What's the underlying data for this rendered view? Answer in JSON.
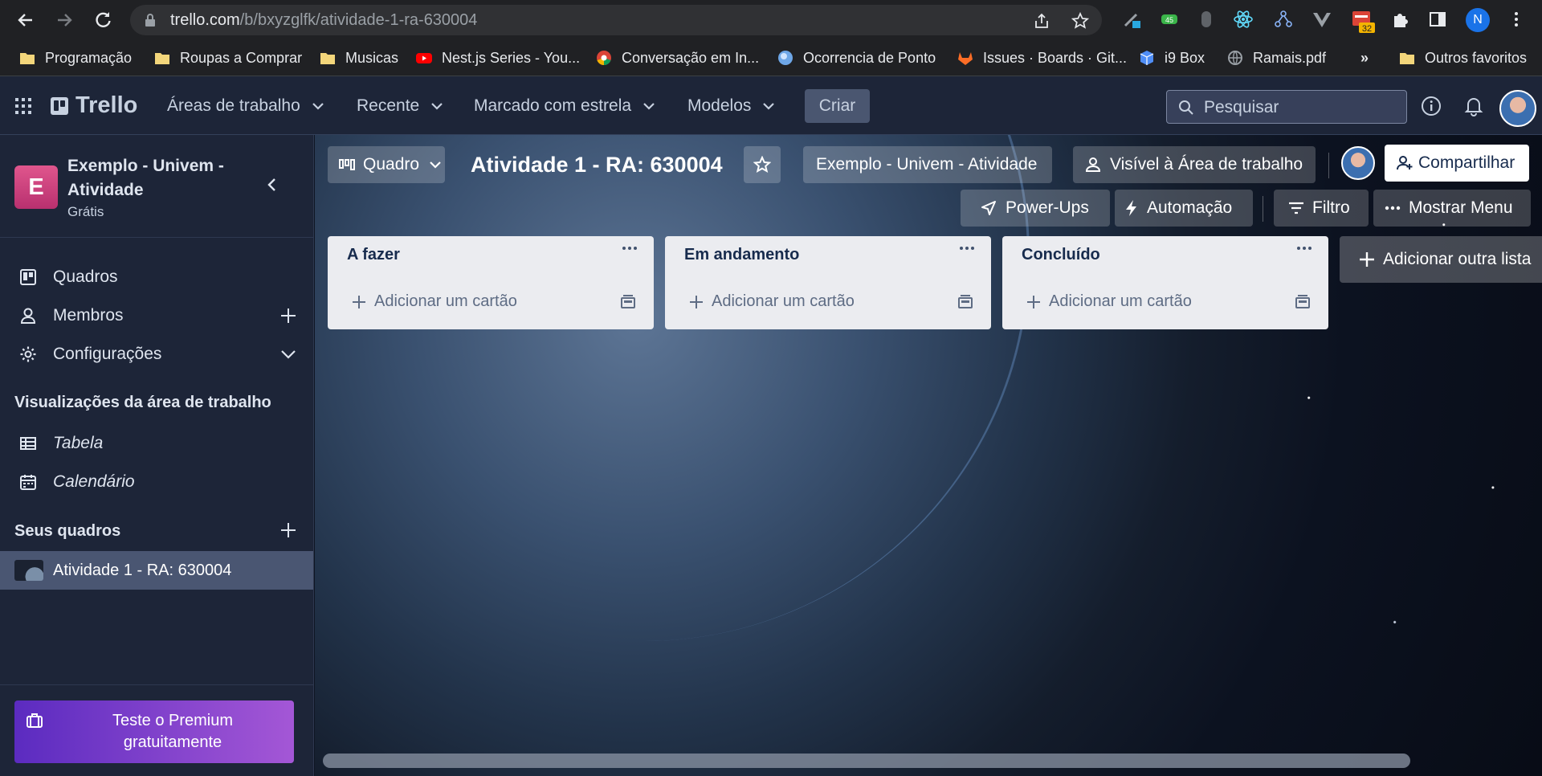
{
  "browser": {
    "url_domain": "trello.com",
    "url_path": "/b/bxyzglfk/atividade-1-ra-630004",
    "ext_badge": "32",
    "profile_initial": "N",
    "bookmarks": [
      {
        "label": "Programação",
        "icon": "folder-icon"
      },
      {
        "label": "Roupas a Comprar",
        "icon": "folder-icon"
      },
      {
        "label": "Musicas",
        "icon": "folder-icon"
      },
      {
        "label": "Nest.js Series - You...",
        "icon": "youtube-icon"
      },
      {
        "label": "Conversação em In...",
        "icon": "chrome-icon"
      },
      {
        "label": "Ocorrencia de Ponto",
        "icon": "globe-icon"
      },
      {
        "label": "Issues · Boards · Git...",
        "icon": "gitlab-icon"
      },
      {
        "label": "i9 Box",
        "icon": "box-icon"
      },
      {
        "label": "Ramais.pdf",
        "icon": "web-icon"
      }
    ],
    "overflow": "»",
    "other_favorites": "Outros favoritos"
  },
  "header": {
    "logo": "Trello",
    "menus": [
      "Áreas de trabalho",
      "Recente",
      "Marcado com estrela",
      "Modelos"
    ],
    "create": "Criar",
    "search_placeholder": "Pesquisar"
  },
  "sidebar": {
    "ws_initial": "E",
    "ws_name": "Exemplo - Univem - Atividade",
    "ws_plan": "Grátis",
    "items": [
      {
        "label": "Quadros",
        "icon": "board-icon"
      },
      {
        "label": "Membros",
        "icon": "person-icon"
      },
      {
        "label": "Configurações",
        "icon": "gear-icon"
      }
    ],
    "views_heading": "Visualizações da área de trabalho",
    "views": [
      {
        "label": "Tabela",
        "icon": "table-icon"
      },
      {
        "label": "Calendário",
        "icon": "calendar-icon"
      }
    ],
    "boards_heading": "Seus quadros",
    "boards": [
      {
        "label": "Atividade 1 - RA: 630004"
      }
    ],
    "premium": "Teste o Premium gratuitamente"
  },
  "board": {
    "view": "Quadro",
    "title": "Atividade 1 - RA: 630004",
    "workspace": "Exemplo - Univem - Atividade",
    "visibility": "Visível à Área de trabalho",
    "share": "Compartilhar",
    "powerups": "Power-Ups",
    "automation": "Automação",
    "filter": "Filtro",
    "show_menu": "Mostrar Menu",
    "lists": [
      {
        "title": "A fazer",
        "add_card": "Adicionar um cartão"
      },
      {
        "title": "Em andamento",
        "add_card": "Adicionar um cartão"
      },
      {
        "title": "Concluído",
        "add_card": "Adicionar um cartão"
      }
    ],
    "add_list": "Adicionar outra lista"
  },
  "colors": {
    "header_bg": "#1d2538",
    "list_bg": "#ebecf0",
    "workspace_logo": "#c9387a",
    "premium_start": "#5b2bc0",
    "premium_end": "#a457d6"
  }
}
